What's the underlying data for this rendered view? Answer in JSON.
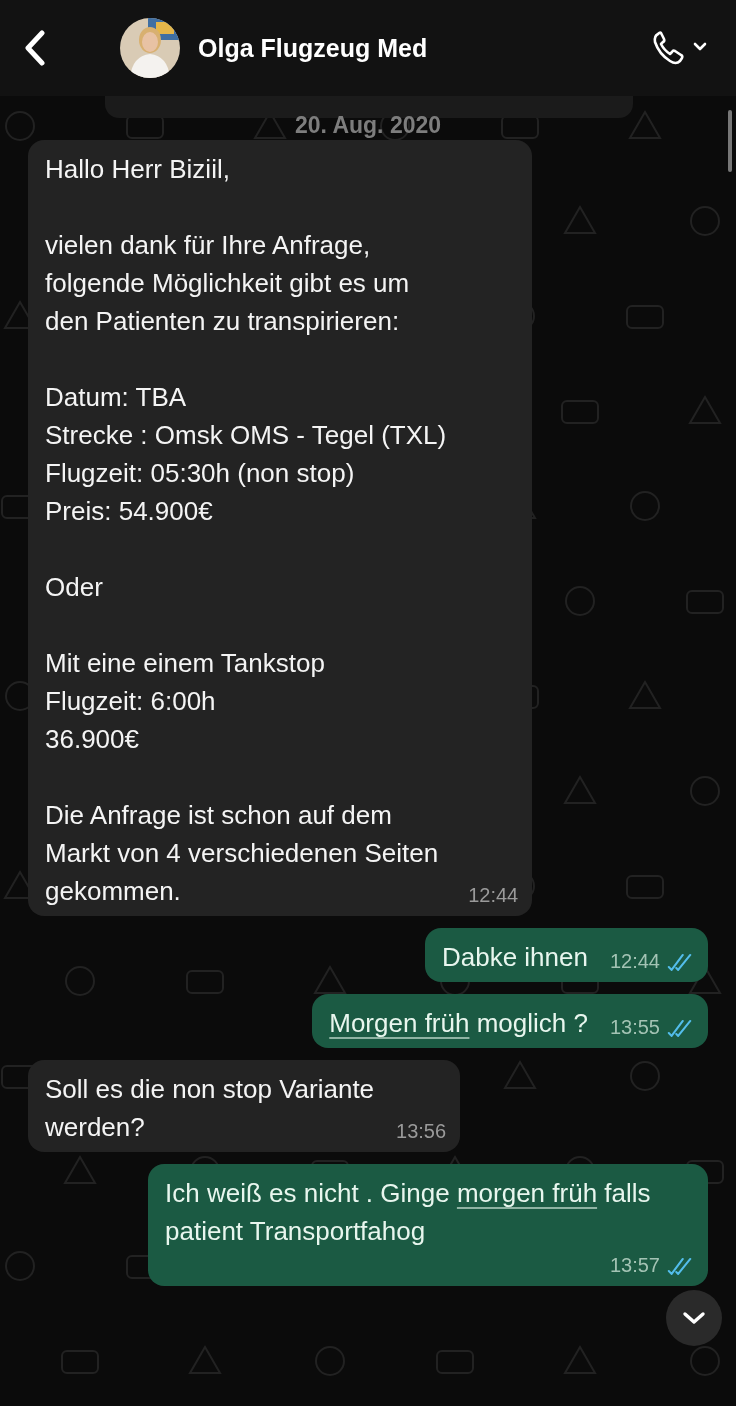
{
  "header": {
    "contact_name": "Olga Flugzeug Med"
  },
  "date_label": "20. Aug. 2020",
  "messages": [
    {
      "outgoing": false,
      "parts": [
        {
          "text": "Hallo Herr Biziil,\n\nvielen dank für Ihre Anfrage,\nfolgende Möglichkeit gibt es um\nden Patienten zu transpirieren:\n\nDatum: TBA\nStrecke : Omsk OMS - Tegel (TXL)\nFlugzeit: 05:30h (non stop)\nPreis: 54.900€\n\nOder\n\nMit eine einem Tankstop\nFlugzeit: 6:00h\n36.900€\n\nDie Anfrage ist schon auf dem\nMarkt von 4 verschiedenen Seiten\ngekommen.",
          "underlined": false
        }
      ],
      "time": "12:44"
    },
    {
      "outgoing": true,
      "parts": [
        {
          "text": "Dabke ihnen",
          "underlined": false
        }
      ],
      "time": "12:44",
      "read": true
    },
    {
      "outgoing": true,
      "parts": [
        {
          "text": "Morgen früh",
          "underlined": true
        },
        {
          "text": " moglich ?",
          "underlined": false
        }
      ],
      "time": "13:55",
      "read": true
    },
    {
      "outgoing": false,
      "parts": [
        {
          "text": "Soll es die non stop Variante\nwerden?",
          "underlined": false
        }
      ],
      "time": "13:56"
    },
    {
      "outgoing": true,
      "parts": [
        {
          "text": "Ich weiß es nicht . Ginge ",
          "underlined": false
        },
        {
          "text": "morgen früh",
          "underlined": true
        },
        {
          "text": " falls patient Transportfahog",
          "underlined": false
        }
      ],
      "time": "13:57",
      "read": true
    }
  ]
}
